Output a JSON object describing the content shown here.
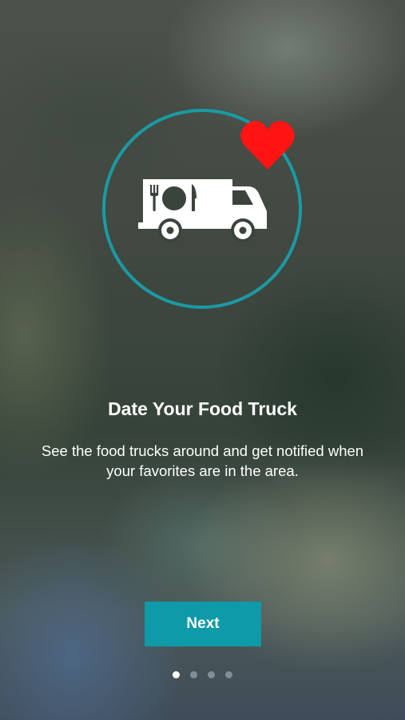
{
  "onboarding": {
    "title": "Date Your Food Truck",
    "description": "See the food trucks around and get notified when your favorites are in the area.",
    "next_label": "Next",
    "page_count": 4,
    "current_page": 1,
    "illustration": {
      "truck_icon": "food-truck-icon",
      "utensils_icon": "fork-plate-knife-icon",
      "heart_icon": "heart-icon"
    }
  },
  "colors": {
    "accent": "#0e9aa8",
    "ring": "#1a9aa5",
    "heart": "#ff1414",
    "text": "#ffffff"
  }
}
